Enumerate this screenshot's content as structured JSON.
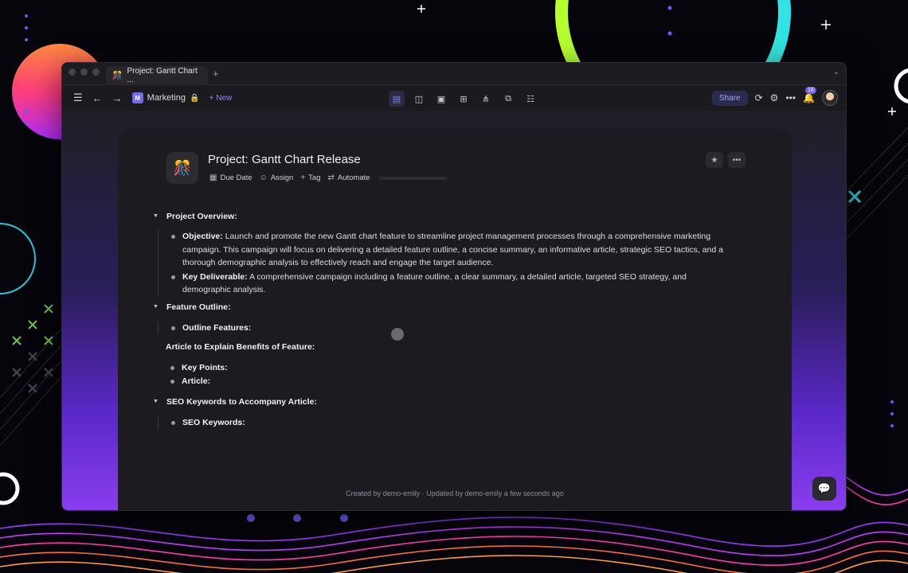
{
  "window": {
    "tab_title": "Project: Gantt Chart ...",
    "tab_icon": "🎊",
    "add_tab": "+",
    "tabs_chevron": "⌄"
  },
  "toolbar": {
    "space_badge": "M",
    "space_name": "Marketing",
    "new_label": "New",
    "share_label": "Share",
    "notification_count": "16"
  },
  "doc": {
    "icon": "🎊",
    "title": "Project: Gantt Chart Release",
    "props": {
      "due_date": "Due Date",
      "assign": "Assign",
      "tag": "Tag",
      "automate": "Automate"
    },
    "sections": [
      {
        "heading": "Project Overview:",
        "bullets": [
          {
            "label": "Objective:",
            "text": "Launch and promote the new Gantt chart feature to streamline project management processes through a comprehensive marketing campaign. This campaign will focus on delivering a detailed feature outline, a concise summary, an informative article, strategic SEO tactics, and a thorough demographic analysis to effectively reach and engage the target audience."
          },
          {
            "label": "Key Deliverable:",
            "text": "A comprehensive campaign including a feature outline, a clear summary, a detailed article, targeted SEO strategy, and demographic analysis."
          }
        ]
      },
      {
        "heading": "Feature Outline:",
        "bullets": [
          {
            "label": "Outline Features:",
            "text": ""
          }
        ]
      },
      {
        "heading": "SEO Keywords to Accompany Article:",
        "bullets": [
          {
            "label": "SEO Keywords:",
            "text": ""
          }
        ]
      }
    ],
    "article_heading": "Article to Explain Benefits of Feature:",
    "article_bullets": [
      {
        "label": "Key Points:"
      },
      {
        "label": "Article:"
      }
    ],
    "footer": "Created by demo-emily · Updated by demo-emily a few seconds ago"
  }
}
